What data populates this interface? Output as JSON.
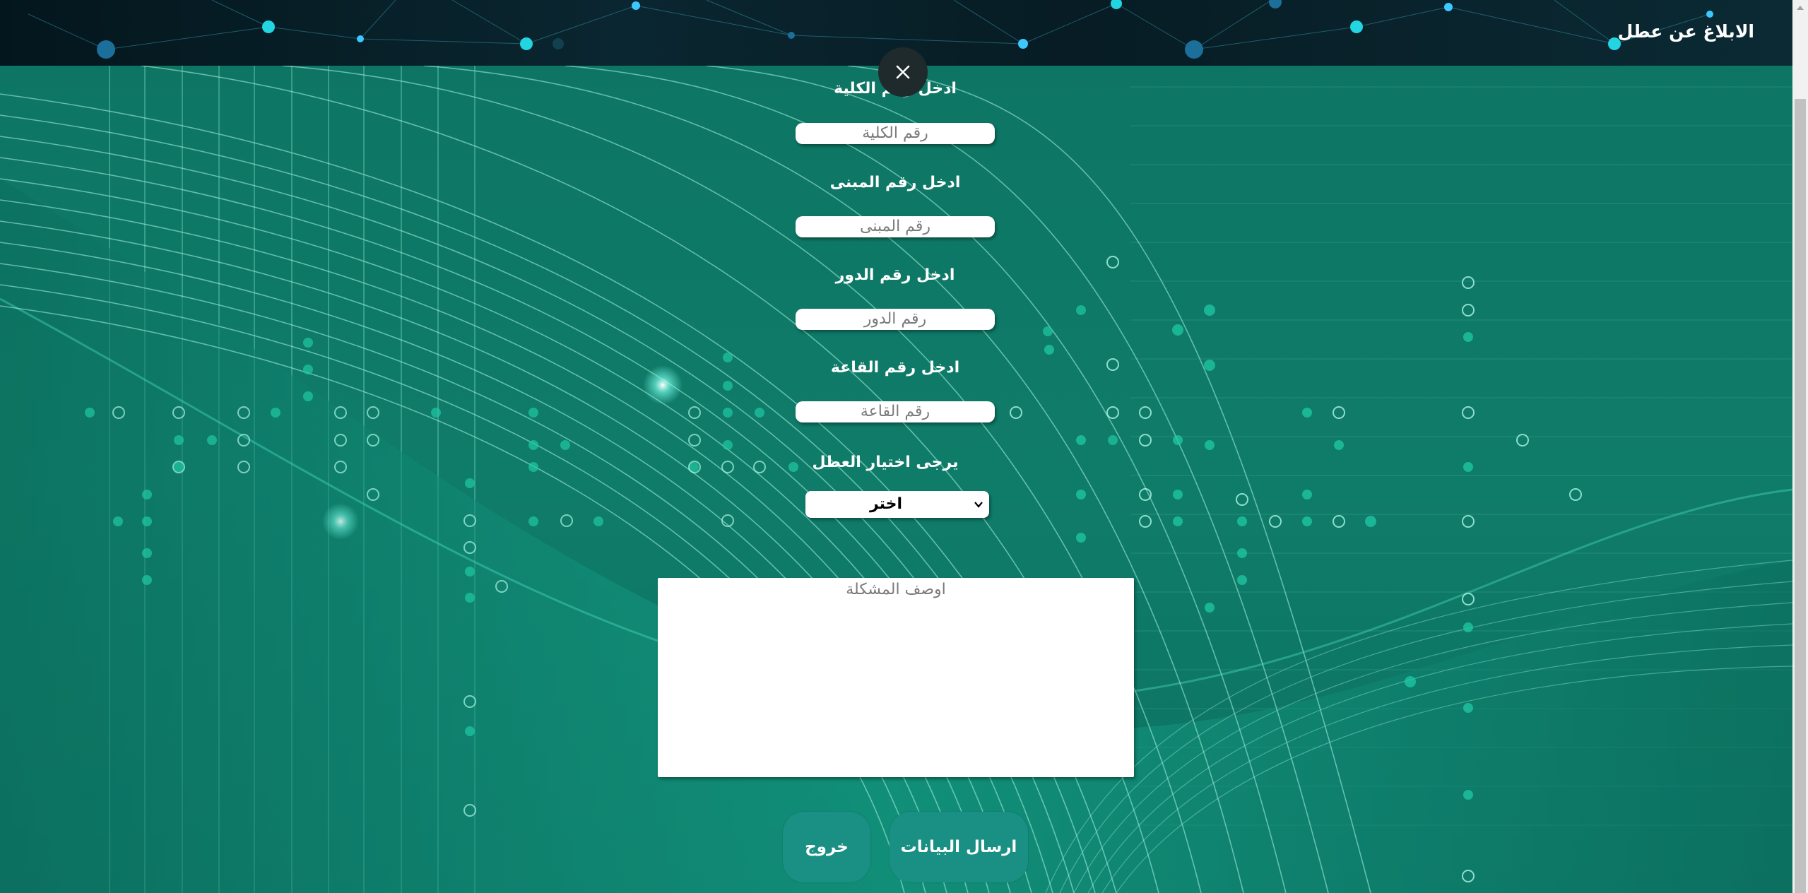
{
  "header": {
    "title": "الابلاغ عن عطل"
  },
  "form": {
    "college": {
      "label": "ادخل رقم الكلية",
      "placeholder": "رقم الكلية"
    },
    "building": {
      "label": "ادخل رقم المبنى",
      "placeholder": "رقم المبنى"
    },
    "floor": {
      "label": "ادخل رقم الدور",
      "placeholder": "رقم الدور"
    },
    "room": {
      "label": "ادخل رقم القاعة",
      "placeholder": "رقم القاعة"
    },
    "fault": {
      "label": "يرجى اختيار العطل",
      "selected": "اختر"
    },
    "description": {
      "placeholder": "اوصف المشكلة"
    }
  },
  "buttons": {
    "send": "ارسال البيانات",
    "exit": "خروج"
  },
  "colors": {
    "background": "#0f7a68",
    "button": "#1a8f84",
    "header": "#071c24"
  },
  "icons": {
    "close": "close-icon",
    "select_arrow": "chevron-down-icon"
  }
}
